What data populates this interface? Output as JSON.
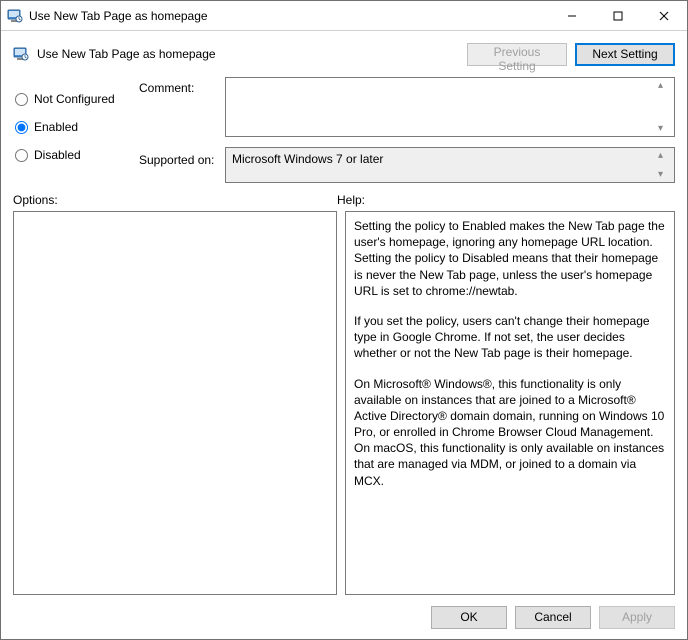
{
  "window": {
    "title": "Use New Tab Page as homepage"
  },
  "header": {
    "title": "Use New Tab Page as homepage",
    "previous_setting": "Previous Setting",
    "next_setting": "Next Setting"
  },
  "state": {
    "not_configured": "Not Configured",
    "enabled": "Enabled",
    "disabled": "Disabled",
    "selected": "enabled"
  },
  "fields": {
    "comment_label": "Comment:",
    "comment_value": "",
    "supported_label": "Supported on:",
    "supported_value": "Microsoft Windows 7 or later"
  },
  "labels": {
    "options": "Options:",
    "help": "Help:"
  },
  "help": {
    "p1": "Setting the policy to Enabled makes the New Tab page the user's homepage, ignoring any homepage URL location. Setting the policy to Disabled means that their homepage is never the New Tab page, unless the user's homepage URL is set to chrome://newtab.",
    "p2": "If you set the policy, users can't change their homepage type in Google Chrome. If not set, the user decides whether or not the New Tab page is their homepage.",
    "p3": "On Microsoft® Windows®, this functionality is only available on instances that are joined to a Microsoft® Active Directory® domain domain, running on Windows 10 Pro, or enrolled in Chrome Browser Cloud Management. On macOS, this functionality is only available on instances that are managed via MDM, or joined to a domain via MCX."
  },
  "footer": {
    "ok": "OK",
    "cancel": "Cancel",
    "apply": "Apply"
  }
}
